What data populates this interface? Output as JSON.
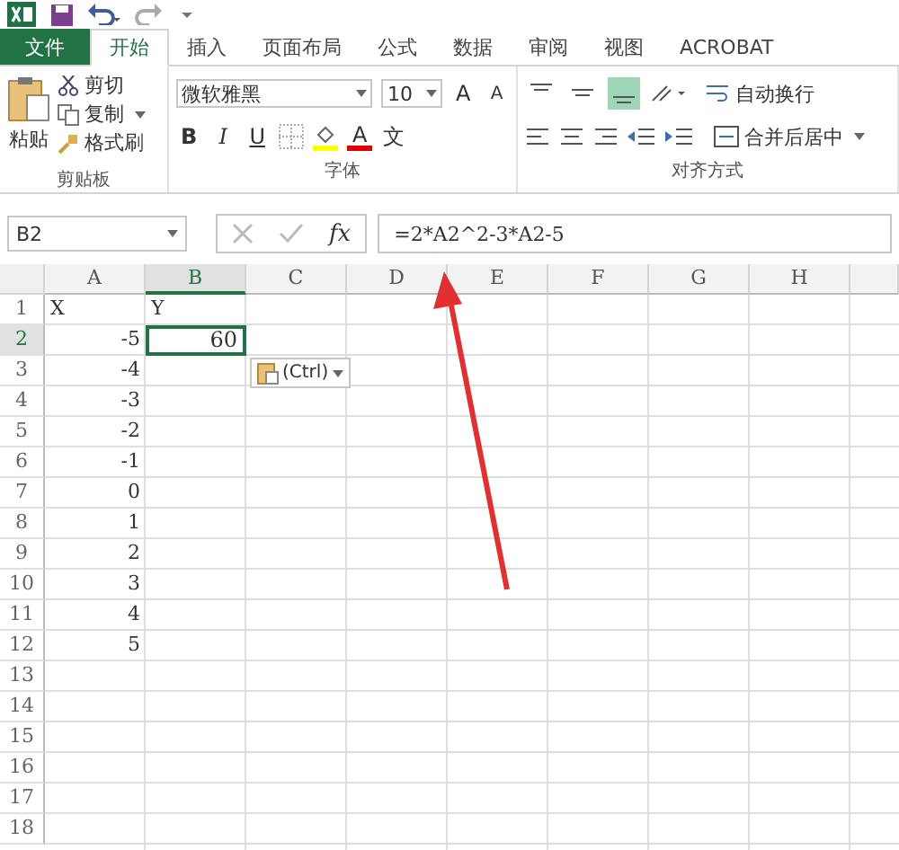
{
  "tabs": [
    {
      "label": "文件",
      "kind": "file",
      "selected": false
    },
    {
      "label": "开始",
      "kind": "tab",
      "selected": true
    },
    {
      "label": "插入",
      "kind": "tab",
      "selected": false
    },
    {
      "label": "页面布局",
      "kind": "tab",
      "selected": false
    },
    {
      "label": "公式",
      "kind": "tab",
      "selected": false
    },
    {
      "label": "数据",
      "kind": "tab",
      "selected": false
    },
    {
      "label": "审阅",
      "kind": "tab",
      "selected": false
    },
    {
      "label": "视图",
      "kind": "tab",
      "selected": false
    },
    {
      "label": "ACROBAT",
      "kind": "tab",
      "selected": false
    }
  ],
  "clipboard": {
    "paste": "粘贴",
    "cut": "剪切",
    "copy": "复制",
    "format_painter": "格式刷",
    "label": "剪贴板"
  },
  "font": {
    "name": "微软雅黑",
    "size": "10",
    "grow": "A",
    "shrink": "A",
    "bold": "B",
    "italic": "I",
    "underline": "U",
    "font_color": "A",
    "phonetic": "文",
    "label": "字体"
  },
  "alignment": {
    "vertical": [
      {
        "kind": "top",
        "selected": false
      },
      {
        "kind": "middle",
        "selected": false
      },
      {
        "kind": "bottom",
        "selected": true
      }
    ],
    "wrap": "自动换行",
    "merge": "合并后居中",
    "label": "对齐方式"
  },
  "formula_bar": {
    "name_box": "B2",
    "fx": "fx",
    "formula": "=2*A2^2-3*A2-5"
  },
  "sheet": {
    "columns": [
      {
        "label": "A",
        "selected": false
      },
      {
        "label": "B",
        "selected": true
      },
      {
        "label": "C",
        "selected": false
      },
      {
        "label": "D",
        "selected": false
      },
      {
        "label": "E",
        "selected": false
      },
      {
        "label": "F",
        "selected": false
      },
      {
        "label": "G",
        "selected": false
      },
      {
        "label": "H",
        "selected": false
      }
    ],
    "rows": [
      {
        "header": "1",
        "selected": false,
        "cells": [
          {
            "text": "X",
            "kind": "text",
            "selected": false
          },
          {
            "text": "Y",
            "kind": "text",
            "selected": false
          }
        ]
      },
      {
        "header": "2",
        "selected": true,
        "cells": [
          {
            "text": "-5",
            "kind": "number",
            "selected": false
          },
          {
            "text": "60",
            "kind": "number",
            "selected": true
          }
        ]
      },
      {
        "header": "3",
        "selected": false,
        "cells": [
          {
            "text": "-4",
            "kind": "number",
            "selected": false
          }
        ]
      },
      {
        "header": "4",
        "selected": false,
        "cells": [
          {
            "text": "-3",
            "kind": "number",
            "selected": false
          }
        ]
      },
      {
        "header": "5",
        "selected": false,
        "cells": [
          {
            "text": "-2",
            "kind": "number",
            "selected": false
          }
        ]
      },
      {
        "header": "6",
        "selected": false,
        "cells": [
          {
            "text": "-1",
            "kind": "number",
            "selected": false
          }
        ]
      },
      {
        "header": "7",
        "selected": false,
        "cells": [
          {
            "text": "0",
            "kind": "number",
            "selected": false
          }
        ]
      },
      {
        "header": "8",
        "selected": false,
        "cells": [
          {
            "text": "1",
            "kind": "number",
            "selected": false
          }
        ]
      },
      {
        "header": "9",
        "selected": false,
        "cells": [
          {
            "text": "2",
            "kind": "number",
            "selected": false
          }
        ]
      },
      {
        "header": "10",
        "selected": false,
        "cells": [
          {
            "text": "3",
            "kind": "number",
            "selected": false
          }
        ]
      },
      {
        "header": "11",
        "selected": false,
        "cells": [
          {
            "text": "4",
            "kind": "number",
            "selected": false
          }
        ]
      },
      {
        "header": "12",
        "selected": false,
        "cells": [
          {
            "text": "5",
            "kind": "number",
            "selected": false
          }
        ]
      },
      {
        "header": "13",
        "selected": false,
        "cells": []
      },
      {
        "header": "14",
        "selected": false,
        "cells": []
      },
      {
        "header": "15",
        "selected": false,
        "cells": []
      },
      {
        "header": "16",
        "selected": false,
        "cells": []
      },
      {
        "header": "17",
        "selected": false,
        "cells": []
      },
      {
        "header": "18",
        "selected": false,
        "cells": []
      }
    ],
    "paste_options": "(Ctrl)"
  }
}
